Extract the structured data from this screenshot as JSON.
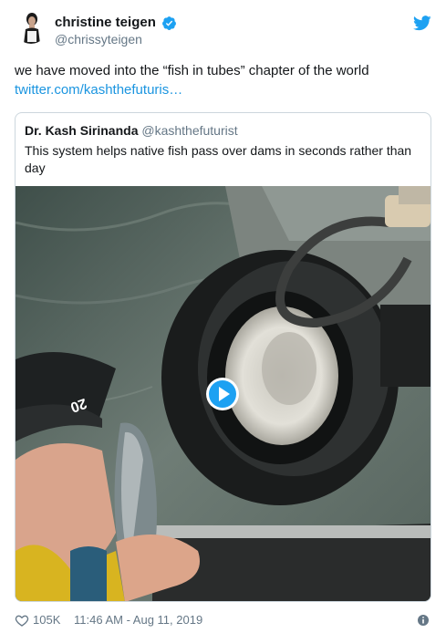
{
  "author": {
    "display_name": "christine teigen",
    "handle": "@chrissyteigen"
  },
  "tweet": {
    "text": "we have moved into the “fish in tubes” chapter of the world",
    "link": "twitter.com/kashthefuturis…"
  },
  "quote": {
    "display_name": "Dr. Kash Sirinanda",
    "handle": "@kashthefuturist",
    "text": "This system helps native fish pass over dams in seconds rather than day"
  },
  "video": {
    "jersey_number": "20"
  },
  "footer": {
    "like_count": "105K",
    "timestamp": "11:46 AM - Aug 11, 2019"
  },
  "icons": {
    "verified": "verified-badge-icon",
    "bird": "twitter-bird-icon",
    "play": "play-icon",
    "heart": "heart-icon",
    "info": "info-icon"
  },
  "colors": {
    "link": "#1b95e0",
    "verified": "#1da1f2",
    "secondary_text": "#657786",
    "border": "#ccd6dd"
  }
}
